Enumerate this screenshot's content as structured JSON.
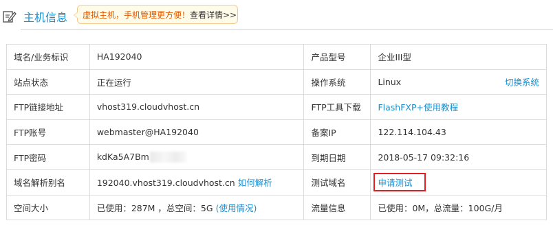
{
  "header": {
    "icon": "edit-document-icon",
    "title": "主机信息",
    "promo_text": "虚拟主机，手机管理更方便！",
    "promo_link": "查看详情>>"
  },
  "rows": [
    {
      "label1": "域名/业务标识",
      "value1": "HA192040",
      "label2": "产品型号",
      "value2": "企业III型"
    },
    {
      "label1": "站点状态",
      "value1": "正在运行",
      "label2": "操作系统",
      "value2": "Linux",
      "action2": "切换系统"
    },
    {
      "label1": "FTP链接地址",
      "value1": "vhost319.cloudvhost.cn",
      "label2": "FTP工具下载",
      "value2": "FlashFXP+使用教程"
    },
    {
      "label1": "FTP账号",
      "value1": "webmaster@HA192040",
      "label2": "备案IP",
      "value2": "122.114.104.43"
    },
    {
      "label1": "FTP密码",
      "value1": "kdKa5A7Bm",
      "label2": "到期日期",
      "value2": "2018-05-17 09:32:16"
    },
    {
      "label1": "域名解析别名",
      "value1": "192040.vhost319.cloudvhost.cn",
      "action1": "如何解析",
      "label2": "测试域名",
      "value2": "申请测试"
    },
    {
      "label1": "空间大小",
      "value1": "已使用：287M ，总空间：5G",
      "action1": "(使用情况)",
      "label2": "流量信息",
      "value2": "已使用：0M，总流量：100G/月"
    }
  ],
  "colors": {
    "accent": "#1a8fd0",
    "promo": "#e05a00",
    "highlight_border": "#e02020"
  }
}
